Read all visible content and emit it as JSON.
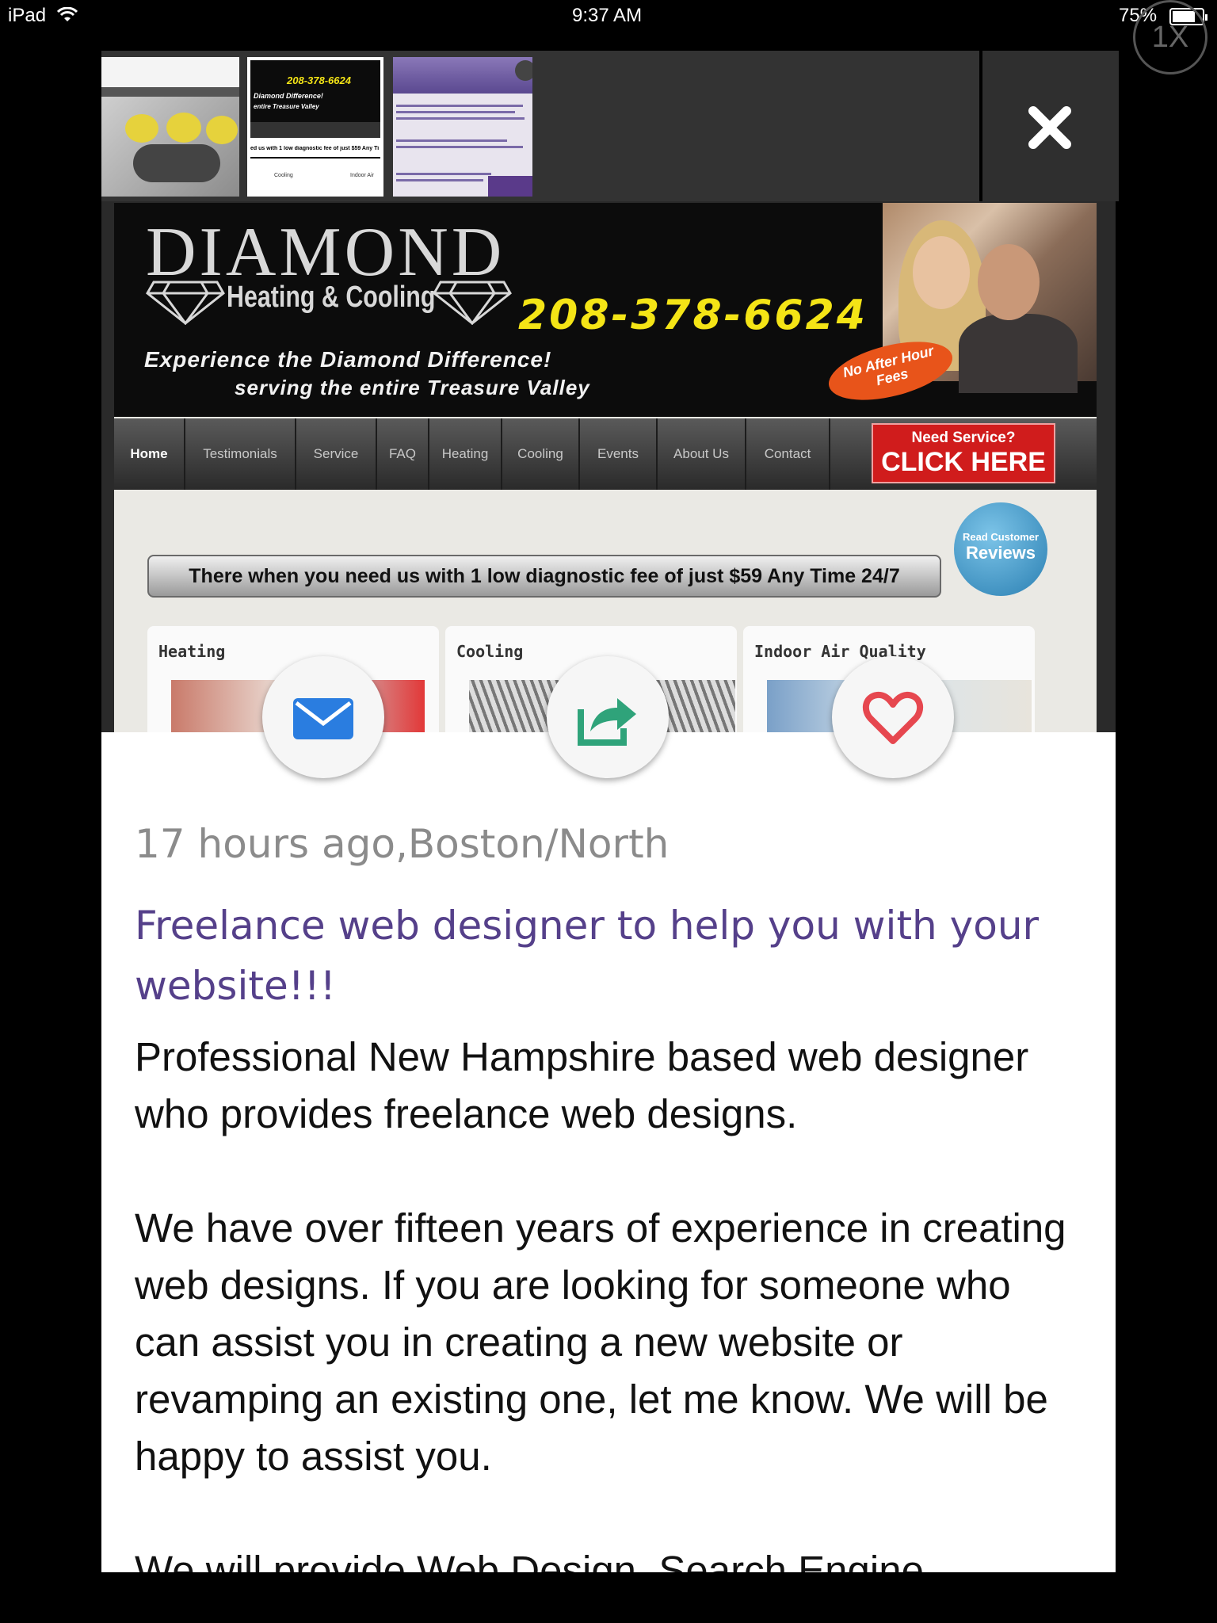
{
  "status_bar": {
    "device": "iPad",
    "time": "9:37 AM",
    "battery": "75%"
  },
  "zoom": {
    "label": "1X"
  },
  "thumbnails": [
    {
      "name": "thumb-jewelry"
    },
    {
      "name": "thumb-diamond-hvac",
      "phone": "208-378-6624",
      "caption": "Diamond Difference!",
      "caption2": "entire Treasure Valley",
      "bar": "ed us with 1 low diagnostic fee of just $59 Any Ti",
      "label_cooling": "Cooling",
      "label_indoor": "Indoor Air"
    },
    {
      "name": "thumb-purple-site"
    }
  ],
  "preview_site": {
    "logo_main": "DIAMOND",
    "logo_sub": "Heating & Cooling",
    "phone": "208-378-6624",
    "tagline1": "Experience the Diamond Difference!",
    "tagline2": "serving the entire Treasure Valley",
    "badge": "No After Hour Fees",
    "nav": [
      "Home",
      "Testimonials",
      "Service",
      "FAQ",
      "Heating",
      "Cooling",
      "Events",
      "About Us",
      "Contact"
    ],
    "cta_top": "Need Service?",
    "cta_bottom": "CLICK HERE",
    "reviews_top": "Read Customer",
    "reviews_main": "Reviews",
    "promo": "There when you need us with 1 low diagnostic fee of just $59 Any Time 24/7",
    "cards": [
      "Heating",
      "Cooling",
      "Indoor Air Quality"
    ]
  },
  "listing": {
    "meta": "17 hours ago,Boston/North",
    "title": "Freelance web designer to help you with your website!!!",
    "paragraphs": [
      "Professional New Hampshire based web designer who provides freelance web designs.",
      "We have over fifteen years of experience in creating web designs. If you are looking for someone who can assist you in creating a new website or revamping an existing one, let me know. We will be happy to assist you.",
      "We will provide Web Design, Search Engine"
    ]
  },
  "colors": {
    "title": "#55408a",
    "meta": "#8b8b8b",
    "mail_icon": "#2a7de0",
    "share_icon": "#2fa37a",
    "heart_icon": "#e6474f"
  },
  "icons": [
    "wifi-icon",
    "battery-icon",
    "close-icon",
    "mail-icon",
    "share-icon",
    "heart-icon"
  ]
}
